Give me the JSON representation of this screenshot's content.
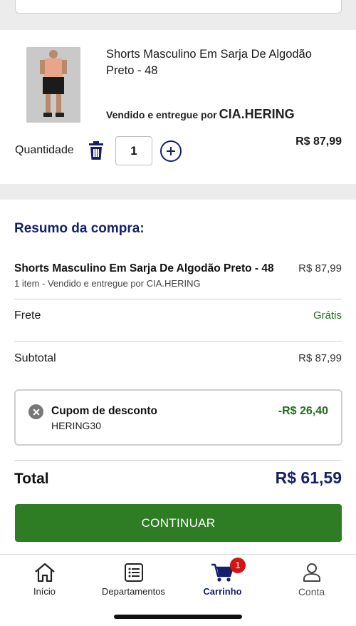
{
  "product": {
    "name": "Shorts Masculino Em Sarja De Algodão Preto - 48",
    "seller_prefix": "Vendido e entregue por",
    "seller_brand": "CIA.HERING",
    "quantity_label": "Quantidade",
    "quantity_value": "1",
    "price": "R$ 87,99"
  },
  "summary": {
    "title": "Resumo da compra:",
    "item_name": "Shorts Masculino Em Sarja De Algodão Preto - 48",
    "item_price": "R$ 87,99",
    "item_sub": "1 item - Vendido e entregue por CIA.HERING",
    "shipping_label": "Frete",
    "shipping_value": "Grátis",
    "subtotal_label": "Subtotal",
    "subtotal_value": "R$ 87,99"
  },
  "coupon": {
    "title": "Cupom de desconto",
    "code": "HERING30",
    "value": "-R$ 26,40"
  },
  "total": {
    "label": "Total",
    "value": "R$ 61,59"
  },
  "continue_label": "CONTINUAR",
  "tabbar": {
    "items": [
      {
        "label": "Início",
        "icon": "home-icon"
      },
      {
        "label": "Departamentos",
        "icon": "list-icon"
      },
      {
        "label": "Carrinho",
        "icon": "cart-icon",
        "badge": "1"
      },
      {
        "label": "Conta",
        "icon": "user-icon"
      }
    ]
  },
  "colors": {
    "brand_navy": "#14206b",
    "accent_green": "#2e7d24",
    "badge_red": "#d21414"
  }
}
